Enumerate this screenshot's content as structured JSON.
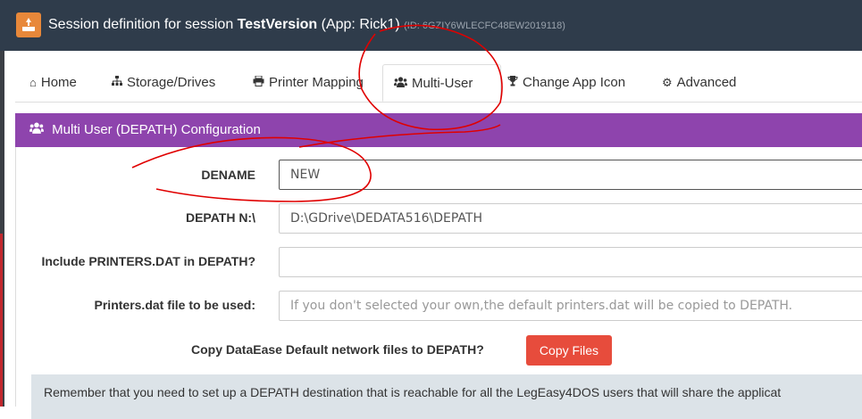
{
  "header": {
    "title_prefix": "Session definition for session ",
    "session_name": "TestVersion",
    "app_part": " (App: Rick1)",
    "id_text": "(ID: 6GZIY6WLECFC48EW2019118)"
  },
  "tabs": [
    {
      "label": "Home",
      "icon": "home-icon"
    },
    {
      "label": "Storage/Drives",
      "icon": "sitemap-icon"
    },
    {
      "label": "Printer Mapping",
      "icon": "print-icon"
    },
    {
      "label": "Multi-User",
      "icon": "users-icon",
      "active": true
    },
    {
      "label": "Change App Icon",
      "icon": "trophy-icon"
    },
    {
      "label": "Advanced",
      "icon": "gears-icon"
    }
  ],
  "section": {
    "title": "Multi User (DEPATH) Configuration",
    "icon": "users-icon",
    "color": "#8e44ad"
  },
  "form": {
    "dename_label": "DENAME",
    "dename_value": "NEW",
    "depath_label": "DEPATH N:\\",
    "depath_value": "D:\\GDrive\\DEDATA516\\DEPATH",
    "include_printers_label": "Include PRINTERS.DAT in DEPATH?",
    "include_printers_value": "",
    "printers_file_label": "Printers.dat file to be used:",
    "printers_file_placeholder": "If you don't selected your own,the default printers.dat  will be copied to DEPATH.",
    "copy_label": "Copy DataEase Default network files to DEPATH?",
    "copy_button": "Copy Files"
  },
  "notice": "Remember that you need to set up a DEPATH destination that is reachable for all the LegEasy4DOS users that will share the applicat",
  "colors": {
    "header_bg": "#2f3c4b",
    "accent_orange": "#e8883a",
    "button_red": "#e74c3c",
    "annotation_red": "#e00000"
  }
}
